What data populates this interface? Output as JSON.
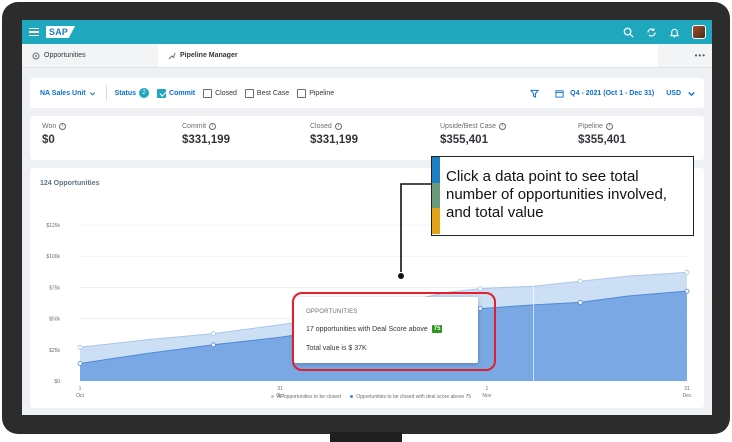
{
  "shell": {
    "logo": "SAP"
  },
  "tabs": [
    {
      "label": "Opportunities",
      "icon": "opportunities-icon"
    },
    {
      "label": "Pipeline Manager",
      "icon": "pipeline-icon",
      "active": true
    }
  ],
  "tab_more": "•••",
  "filters": {
    "sales_unit": "NA Sales Unit",
    "status_label": "Status",
    "status_count": "2",
    "checkboxes": [
      {
        "label": "Commit",
        "checked": true
      },
      {
        "label": "Closed",
        "checked": false
      },
      {
        "label": "Best Case",
        "checked": false
      },
      {
        "label": "Pipeline",
        "checked": false
      }
    ],
    "date_range": "Q4 - 2021 (Oct 1 - Dec 31)",
    "currency": "USD"
  },
  "kpis": [
    {
      "label": "Won",
      "value": "$0"
    },
    {
      "label": "Commit",
      "value": "$331,199"
    },
    {
      "label": "Closed",
      "value": "$331,199"
    },
    {
      "label": "Upside/Best Case",
      "value": "$355,401"
    },
    {
      "label": "Pipeline",
      "value": "$355,401"
    }
  ],
  "chart_title": "124 Opportunities",
  "chart_data": {
    "type": "area",
    "y_ticks": [
      "$0",
      "$25k",
      "$50k",
      "$75k",
      "$100k",
      "$125k"
    ],
    "ylim": [
      0,
      125
    ],
    "x_ticks": [
      {
        "day": "1",
        "month": "Oct",
        "t": 0
      },
      {
        "day": "31",
        "month": "Oct",
        "t": 30
      },
      {
        "day": "1",
        "month": "Nov",
        "t": 61
      },
      {
        "day": "31",
        "month": "Dec",
        "t": 91
      }
    ],
    "xlim": [
      0,
      91
    ],
    "series": [
      {
        "name": "All opportunities to be closed",
        "points": [
          [
            0,
            27
          ],
          [
            10,
            33
          ],
          [
            20,
            38
          ],
          [
            30,
            45
          ],
          [
            38,
            51
          ],
          [
            45,
            56
          ],
          [
            50,
            65
          ],
          [
            55,
            71
          ],
          [
            60,
            74
          ],
          [
            68,
            76
          ],
          [
            75,
            80
          ],
          [
            82,
            84
          ],
          [
            91,
            87
          ]
        ]
      },
      {
        "name": "Opportunities to be closed with deal score above 75",
        "points": [
          [
            0,
            14
          ],
          [
            10,
            22
          ],
          [
            20,
            29
          ],
          [
            30,
            35
          ],
          [
            38,
            41
          ],
          [
            45,
            45
          ],
          [
            50,
            49
          ],
          [
            55,
            53
          ],
          [
            60,
            58
          ],
          [
            68,
            61
          ],
          [
            75,
            63
          ],
          [
            82,
            68
          ],
          [
            91,
            72
          ]
        ]
      }
    ],
    "colors": {
      "all": "#bcd4f0",
      "scored": "#6a9fe0",
      "line_all": "#a9c6ea",
      "line_scored": "#4f8ad8"
    }
  },
  "tooltip": {
    "header": "OPPORTUNITIES",
    "line1": "17 opportunities with Deal Score above",
    "score": "75",
    "line2": "Total value is $ 37K"
  },
  "callout": {
    "text": "Click a data point to see total number of opportunities involved, and total value",
    "bar_colors": [
      "#1f7fc4",
      "#6a9a7a",
      "#e3a21a"
    ]
  }
}
